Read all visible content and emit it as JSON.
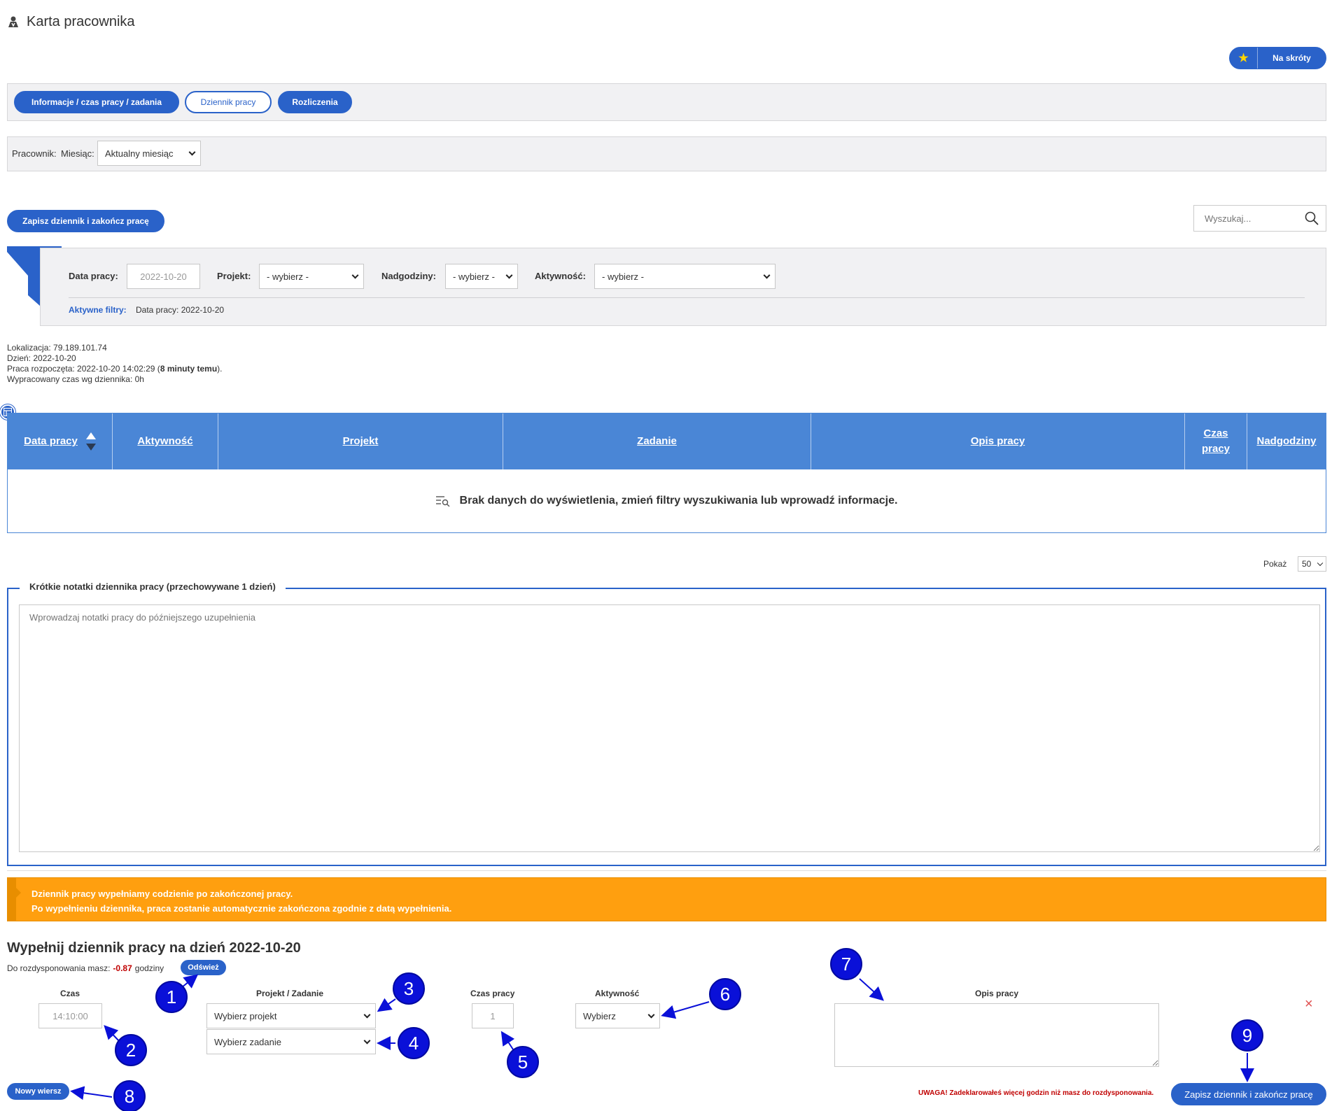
{
  "header": {
    "title": "Karta pracownika",
    "shortcuts_label": "Na skróty"
  },
  "tabs": [
    {
      "label": "Informacje / czas pracy / zadania"
    },
    {
      "label": "Dziennik pracy"
    },
    {
      "label": "Rozliczenia"
    }
  ],
  "filter_bar": {
    "employee_label": "Pracownik:",
    "month_label": "Miesiąc:",
    "month_value": "Aktualny miesiąc"
  },
  "save_top_label": "Zapisz dziennik i zakończ pracę",
  "search": {
    "placeholder": "Wyszukaj..."
  },
  "filters": {
    "date_label": "Data pracy:",
    "date_value": "2022-10-20",
    "project_label": "Projekt:",
    "project_value": "- wybierz -",
    "overtime_label": "Nadgodziny:",
    "overtime_value": "- wybierz -",
    "activity_label": "Aktywność:",
    "activity_value": "- wybierz -",
    "active_label": "Aktywne filtry:",
    "active_value": "Data pracy: 2022-10-20"
  },
  "info": {
    "location": "Lokalizacja: 79.189.101.74",
    "day": "Dzień: 2022-10-20",
    "started_prefix": "Praca rozpoczęta: 2022-10-20 14:02:29 (",
    "started_bold": "8 minuty temu",
    "started_suffix": ").",
    "worked": "Wypracowany czas wg dziennika: 0h"
  },
  "table": {
    "headers": [
      "Data pracy",
      "Aktywność",
      "Projekt",
      "Zadanie",
      "Opis pracy",
      "Czas pracy",
      "Nadgodziny"
    ],
    "empty_message": "Brak danych do wyświetlenia, zmień filtry wyszukiwania lub wprowadź informacje."
  },
  "pagination": {
    "show_label": "Pokaż",
    "show_value": "50"
  },
  "notes": {
    "legend": "Krótkie notatki dziennika pracy (przechowywane 1 dzień)",
    "placeholder": "Wprowadzaj notatki pracy do późniejszego uzupełnienia"
  },
  "alert": {
    "line1": "Dziennik pracy wypełniamy codzienie po zakończonej pracy.",
    "line2": "Po wypełnieniu dziennika, praca zostanie automatycznie zakończona zgodnie z datą wypełnienia."
  },
  "form": {
    "title": "Wypełnij dziennik pracy na dzień 2022-10-20",
    "remaining_prefix": "Do rozdysponowania masz:",
    "remaining_value": "-0.87",
    "remaining_suffix": "godziny",
    "refresh_label": "Odśwież",
    "time_header": "Czas",
    "time_value": "14:10:00",
    "project_header": "Projekt / Zadanie",
    "project_placeholder": "Wybierz projekt",
    "task_placeholder": "Wybierz zadanie",
    "worktime_header": "Czas pracy",
    "worktime_value": "1",
    "activity_header": "Aktywność",
    "activity_value": "Wybierz",
    "desc_header": "Opis pracy",
    "remove_symbol": "×",
    "new_row_label": "Nowy wiersz",
    "warning": "UWAGA! Zadeklarowałeś więcej godzin niż masz do rozdysponowania.",
    "save_label": "Zapisz dziennik i zakończ pracę"
  },
  "markers": [
    "1",
    "2",
    "3",
    "4",
    "5",
    "6",
    "7",
    "8",
    "9"
  ],
  "colors": {
    "primary": "#2a62c9",
    "table_header": "#4a86d6",
    "alert": "#ff9f0f",
    "marker": "#0a10d8",
    "warning": "#c00000"
  }
}
